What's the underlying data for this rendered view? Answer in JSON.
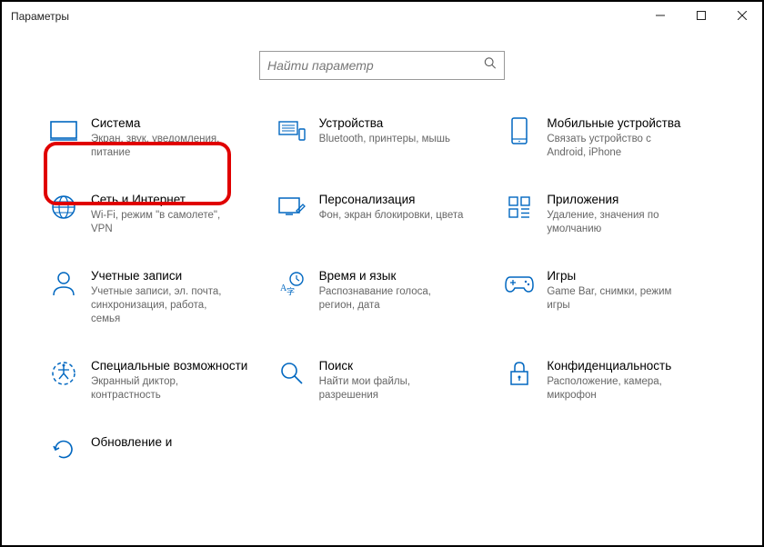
{
  "window": {
    "title": "Параметры"
  },
  "search": {
    "placeholder": "Найти параметр"
  },
  "tiles": [
    {
      "title": "Система",
      "sub": "Экран, звук, уведомления, питание"
    },
    {
      "title": "Устройства",
      "sub": "Bluetooth, принтеры, мышь"
    },
    {
      "title": "Мобильные устройства",
      "sub": "Связать устройство с Android, iPhone"
    },
    {
      "title": "Сеть и Интернет",
      "sub": "Wi-Fi, режим \"в самолете\", VPN"
    },
    {
      "title": "Персонализация",
      "sub": "Фон, экран блокировки, цвета"
    },
    {
      "title": "Приложения",
      "sub": "Удаление, значения по умолчанию"
    },
    {
      "title": "Учетные записи",
      "sub": "Учетные записи, эл. почта, синхронизация, работа, семья"
    },
    {
      "title": "Время и язык",
      "sub": "Распознавание голоса, регион, дата"
    },
    {
      "title": "Игры",
      "sub": "Game Bar, снимки, режим игры"
    },
    {
      "title": "Специальные возможности",
      "sub": "Экранный диктор, контрастность"
    },
    {
      "title": "Поиск",
      "sub": "Найти мои файлы, разрешения"
    },
    {
      "title": "Конфиденциальность",
      "sub": "Расположение, камера, микрофон"
    },
    {
      "title": "Обновление и",
      "sub": ""
    }
  ]
}
